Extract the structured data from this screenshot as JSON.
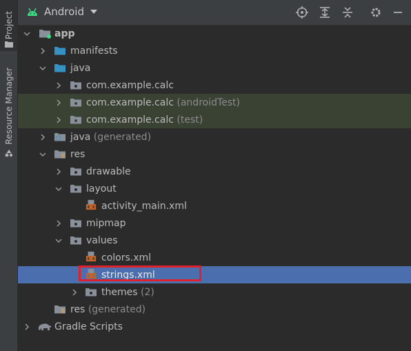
{
  "sidebar": {
    "project_label": "Project",
    "resource_manager_label": "Resource Manager"
  },
  "toolbar": {
    "view_label": "Android",
    "icons": [
      "locate-icon",
      "expand-all-icon",
      "collapse-all-icon",
      "settings-icon",
      "hide-icon"
    ]
  },
  "tree": {
    "app": "app",
    "manifests": "manifests",
    "java": "java",
    "pkg_main": "com.example.calc",
    "pkg_android_test": "com.example.calc",
    "pkg_android_test_suffix": "(androidTest)",
    "pkg_test": "com.example.calc",
    "pkg_test_suffix": "(test)",
    "java_generated": "java",
    "java_generated_suffix": "(generated)",
    "res": "res",
    "drawable": "drawable",
    "layout": "layout",
    "activity_main": "activity_main.xml",
    "mipmap": "mipmap",
    "values": "values",
    "colors": "colors.xml",
    "strings": "strings.xml",
    "themes": "themes",
    "themes_suffix": "(2)",
    "res_generated": "res",
    "res_generated_suffix": "(generated)",
    "gradle_scripts": "Gradle Scripts"
  },
  "colors": {
    "background": "#2b2b2b",
    "selection": "#4b6eaf",
    "test_highlight": "#3a4234",
    "annotation_box": "#e0202b",
    "folder_blue": "#3592c4",
    "xml_orange": "#c0642a"
  }
}
